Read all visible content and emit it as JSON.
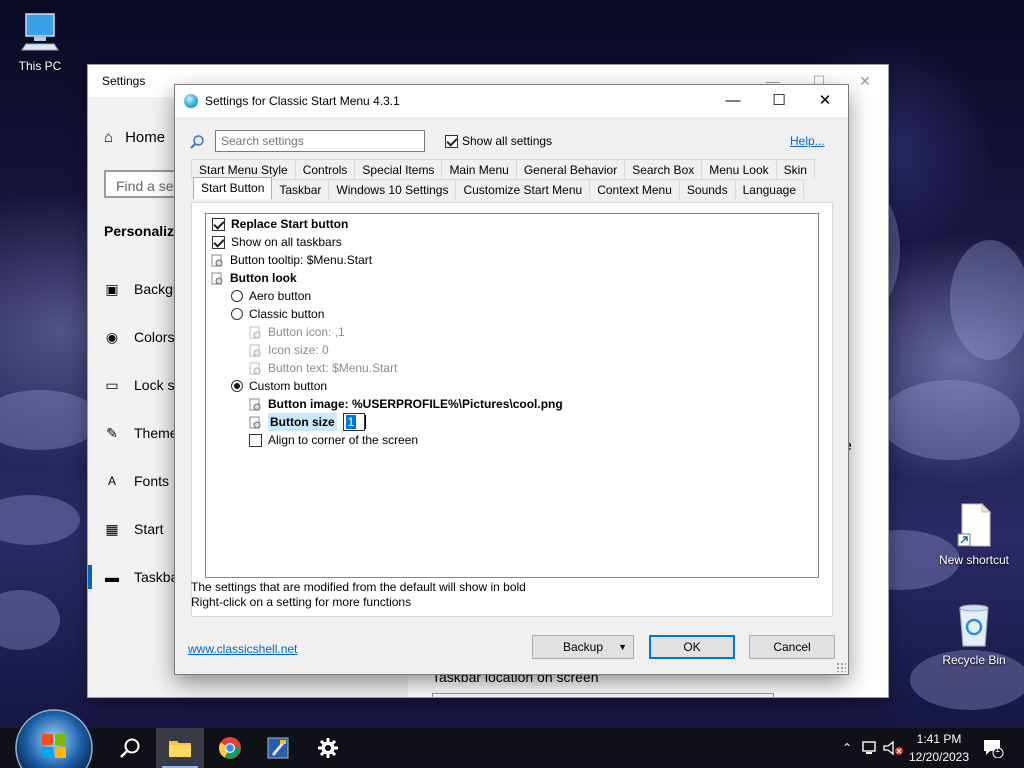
{
  "desktop": {
    "icons": [
      {
        "label": "This PC"
      },
      {
        "label": "New shortcut"
      },
      {
        "label": "Recycle Bin"
      }
    ]
  },
  "settings_window": {
    "title": "Settings",
    "home": "Home",
    "search_placeholder": "Find a set",
    "section": "Personaliza",
    "nav": [
      {
        "label": "Backgr",
        "icon": "picture-icon"
      },
      {
        "label": "Colors",
        "icon": "palette-icon"
      },
      {
        "label": "Lock sc",
        "icon": "monitor-lock-icon"
      },
      {
        "label": "Theme",
        "icon": "brush-icon"
      },
      {
        "label": "Fonts",
        "icon": "font-icon"
      },
      {
        "label": "Start",
        "icon": "start-grid-icon"
      },
      {
        "label": "Taskba",
        "icon": "taskbar-icon"
      }
    ],
    "right_text": "Taskbar location on screen",
    "partial_right_char": "e"
  },
  "dialog": {
    "title": "Settings for Classic Start Menu 4.3.1",
    "search_placeholder": "Search settings",
    "show_all_label": "Show all settings",
    "show_all_checked": true,
    "help_label": "Help...",
    "tabs_row1": [
      "Start Menu Style",
      "Controls",
      "Special Items",
      "Main Menu",
      "General Behavior",
      "Search Box",
      "Menu Look",
      "Skin"
    ],
    "tabs_row2": [
      "Start Button",
      "Taskbar",
      "Windows 10 Settings",
      "Customize Start Menu",
      "Context Menu",
      "Sounds",
      "Language"
    ],
    "selected_tab": "Start Button",
    "settings": {
      "replace_start": "Replace Start button",
      "show_all_taskbars": "Show on all taskbars",
      "tooltip": "Button tooltip: $Menu.Start",
      "button_look": "Button look",
      "aero": "Aero button",
      "classic": "Classic button",
      "icon": "Button icon: ,1",
      "icon_size": "Icon size: 0",
      "text": "Button text: $Menu.Start",
      "custom": "Custom button",
      "image": "Button image: %USERPROFILE%\\Pictures\\cool.png",
      "size_label": "Button size",
      "size_value": "1",
      "align": "Align to corner of the screen"
    },
    "note1": "The settings that are modified from the default will show in bold",
    "note2": "Right-click on a setting for more functions",
    "site_link": "www.classicshell.net",
    "backup": "Backup",
    "ok": "OK",
    "cancel": "Cancel"
  },
  "taskbar": {
    "time": "1:41 PM",
    "date": "12/20/2023",
    "notification_count": "1"
  }
}
